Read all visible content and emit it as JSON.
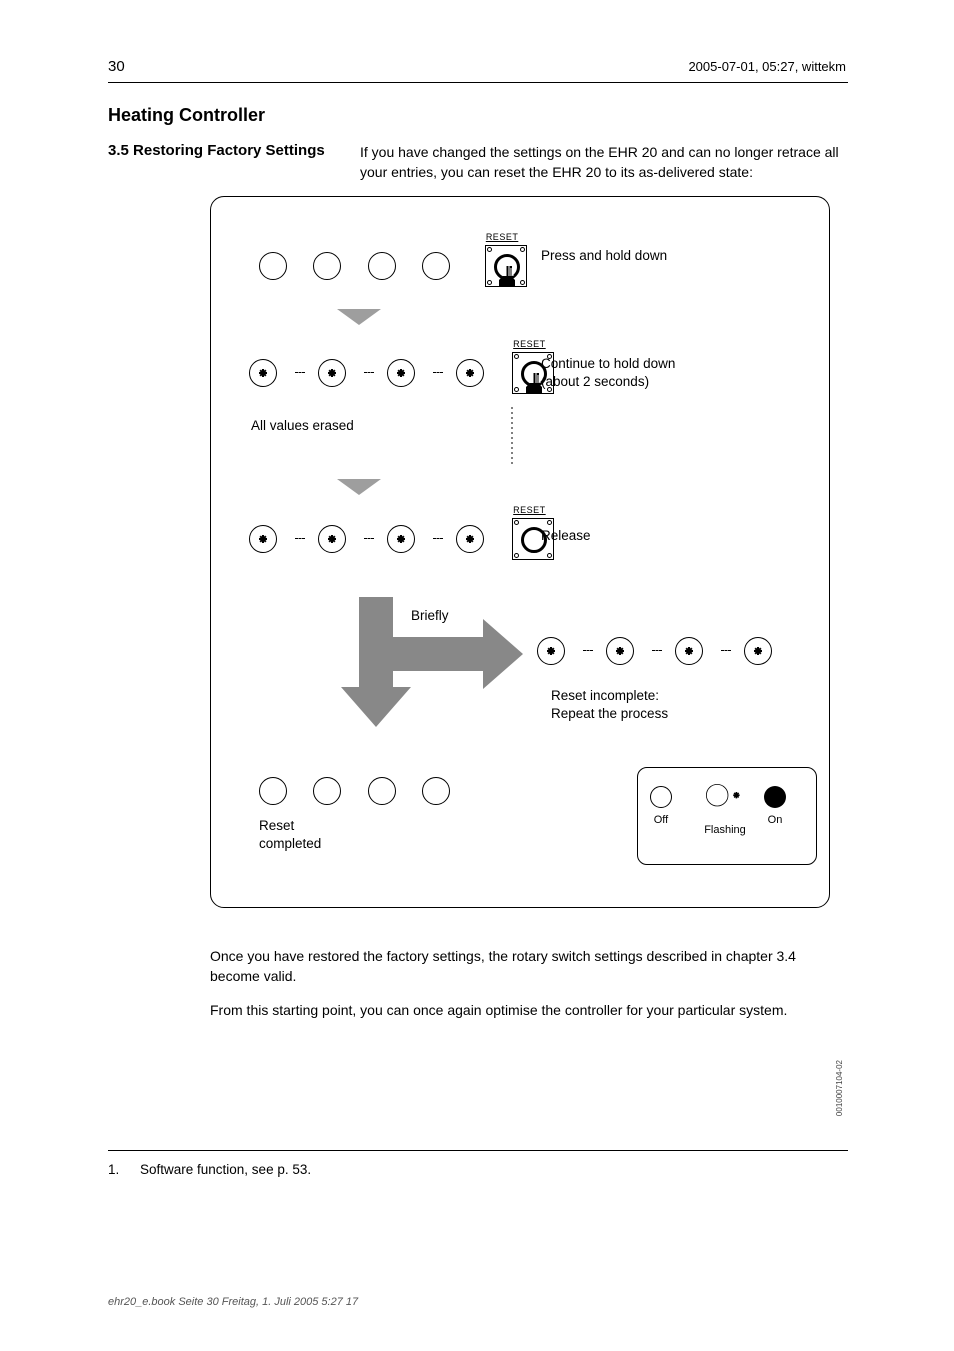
{
  "page_number": "30",
  "header_meta": "2005-07-01, 05:27, wittekm",
  "title": "Heating Controller",
  "section": "3.5  Restoring Factory Settings",
  "intro": "If you have changed the settings on the EHR 20 and can no longer retrace all your entries, you can reset the EHR 20 to its as-delivered state:",
  "diagram": {
    "reset_label": "RESET",
    "row1_label": "Press and hold down",
    "row2_label_a": "Continue to hold down",
    "row2_label_b": "(about 2 seconds)",
    "row3_label": "Release",
    "row4_label": "All values erased",
    "arrow_right_label": "Briefly",
    "result_ok": "Reset\ncompleted",
    "result_fail": "Reset incomplete:\nRepeat the process",
    "legend": {
      "off": "Off",
      "flashing": "Flashing",
      "on": "On"
    }
  },
  "p1": "Once you have restored the factory settings, the rotary switch settings described in chapter 3.4 become valid.",
  "p2": "From this starting point, you can once again optimise the controller for your particular system.",
  "sig": "0010007104-02",
  "footnote_num": "1.",
  "footnote_text": "Software function, see p. 53.",
  "filepath": "ehr20_e.book  Seite 30  Freitag, 1. Juli 2005  5:27 17"
}
